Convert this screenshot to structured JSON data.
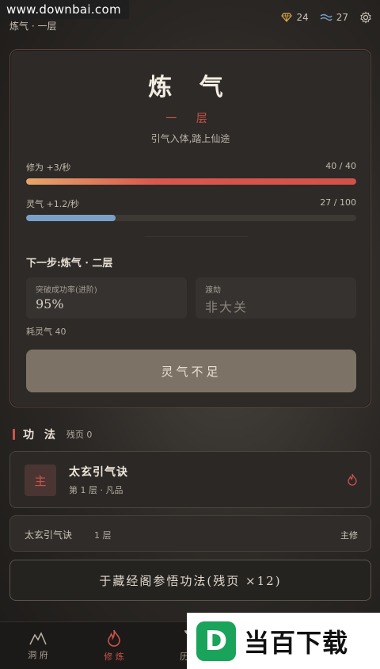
{
  "watermark": "www.downbai.com",
  "header": {
    "realm_small": "炼气 · 一层",
    "gems": "24",
    "spirit_stones": "27"
  },
  "realm": {
    "title": "炼 气",
    "level": "一 层",
    "description": "引气入体,踏上仙途"
  },
  "xiuwei": {
    "label": "修为 +3/秒",
    "value": "40 / 40",
    "fraction": 1.0
  },
  "lingqi": {
    "label": "灵气 +1.2/秒",
    "value": "27 / 100",
    "fraction": 0.27
  },
  "next_step": "下一步:炼气 · 二层",
  "stats": {
    "success_label": "突破成功率(进阶)",
    "success_value": "95%",
    "tribulation_label": "渡劫",
    "tribulation_value": "非大关"
  },
  "cost": "耗灵气 40",
  "breakthrough_button": "灵气不足",
  "skills_section": {
    "title": "功 法",
    "subtitle": "残页 0",
    "main_skill": {
      "badge": "主",
      "name": "太玄引气诀",
      "meta": "第 1 层 · 凡品"
    },
    "row": {
      "name": "太玄引气诀",
      "level": "1 层",
      "tag": "主修"
    },
    "study_button": "于藏经阁参悟功法(残页 ×12)"
  },
  "nav": [
    {
      "label": "洞 府",
      "icon": "mountain-icon"
    },
    {
      "label": "修 炼",
      "icon": "flame-icon"
    },
    {
      "label": "历 练",
      "icon": "sword-icon"
    },
    {
      "label": "",
      "icon": ""
    },
    {
      "label": "",
      "icon": ""
    }
  ],
  "ad": {
    "logo": "D",
    "text": "当百下载"
  },
  "colors": {
    "accent_red": "#c9544a",
    "lingqi_blue": "#7aa0c8",
    "button_disabled": "#7c7366"
  }
}
